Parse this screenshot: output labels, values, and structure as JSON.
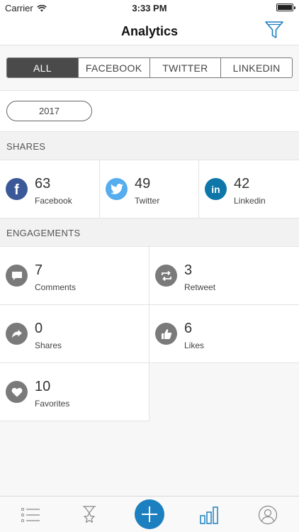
{
  "status_bar": {
    "carrier": "Carrier",
    "time": "3:33 PM"
  },
  "nav": {
    "title": "Analytics",
    "filter_icon": "filter-funnel-icon"
  },
  "segments": [
    {
      "label": "ALL",
      "active": true
    },
    {
      "label": "FACEBOOK",
      "active": false
    },
    {
      "label": "TWITTER",
      "active": false
    },
    {
      "label": "LINKEDIN",
      "active": false
    }
  ],
  "year": "2017",
  "shares": {
    "header": "SHARES",
    "items": [
      {
        "count": "63",
        "label": "Facebook",
        "icon": "facebook-icon",
        "color": "#3b5998"
      },
      {
        "count": "49",
        "label": "Twitter",
        "icon": "twitter-icon",
        "color": "#55acee"
      },
      {
        "count": "42",
        "label": "Linkedin",
        "icon": "linkedin-icon",
        "color": "#0e76a8"
      }
    ]
  },
  "engagements": {
    "header": "ENGAGEMENTS",
    "items": [
      {
        "count": "7",
        "label": "Comments",
        "icon": "comment-icon"
      },
      {
        "count": "3",
        "label": "Retweet",
        "icon": "retweet-icon"
      },
      {
        "count": "0",
        "label": "Shares",
        "icon": "share-arrow-icon"
      },
      {
        "count": "6",
        "label": "Likes",
        "icon": "thumbs-up-icon"
      },
      {
        "count": "10",
        "label": "Favorites",
        "icon": "heart-icon"
      }
    ],
    "icon_color": "#7a7a7a"
  },
  "tab_bar": {
    "tabs": [
      "list-icon",
      "hourglass-star-icon",
      "add-icon",
      "analytics-bars-icon",
      "profile-icon"
    ],
    "accent": "#1c7fc0"
  }
}
